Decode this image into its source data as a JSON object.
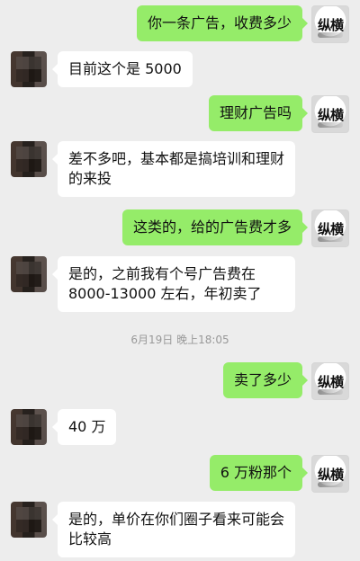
{
  "avatars": {
    "self": {
      "icon": "calligraphy-logo-icon",
      "text": "纵横"
    },
    "other": {
      "icon": "pixelated-avatar-icon"
    }
  },
  "messages": [
    {
      "from": "me",
      "text": "你一条广告，收费多少"
    },
    {
      "from": "other",
      "text": "目前这个是 5000"
    },
    {
      "from": "me",
      "text": "理财广告吗"
    },
    {
      "from": "other",
      "text": "差不多吧，基本都是搞培训和理财的来投"
    },
    {
      "from": "me",
      "text": "这类的，给的广告费才多"
    },
    {
      "from": "other",
      "text": "是的，之前我有个号广告费在 8000-13000 左右，年初卖了"
    },
    {
      "from": "me",
      "text": "卖了多少"
    },
    {
      "from": "other",
      "text": "40 万"
    },
    {
      "from": "me",
      "text": "6 万粉那个"
    },
    {
      "from": "other",
      "text": "是的，单价在你们圈子看来可能会比较高"
    }
  ],
  "timestamp": "6月19日 晚上18:05",
  "colors": {
    "background": "#ededed",
    "my_bubble": "#95ec69",
    "their_bubble": "#ffffff"
  }
}
